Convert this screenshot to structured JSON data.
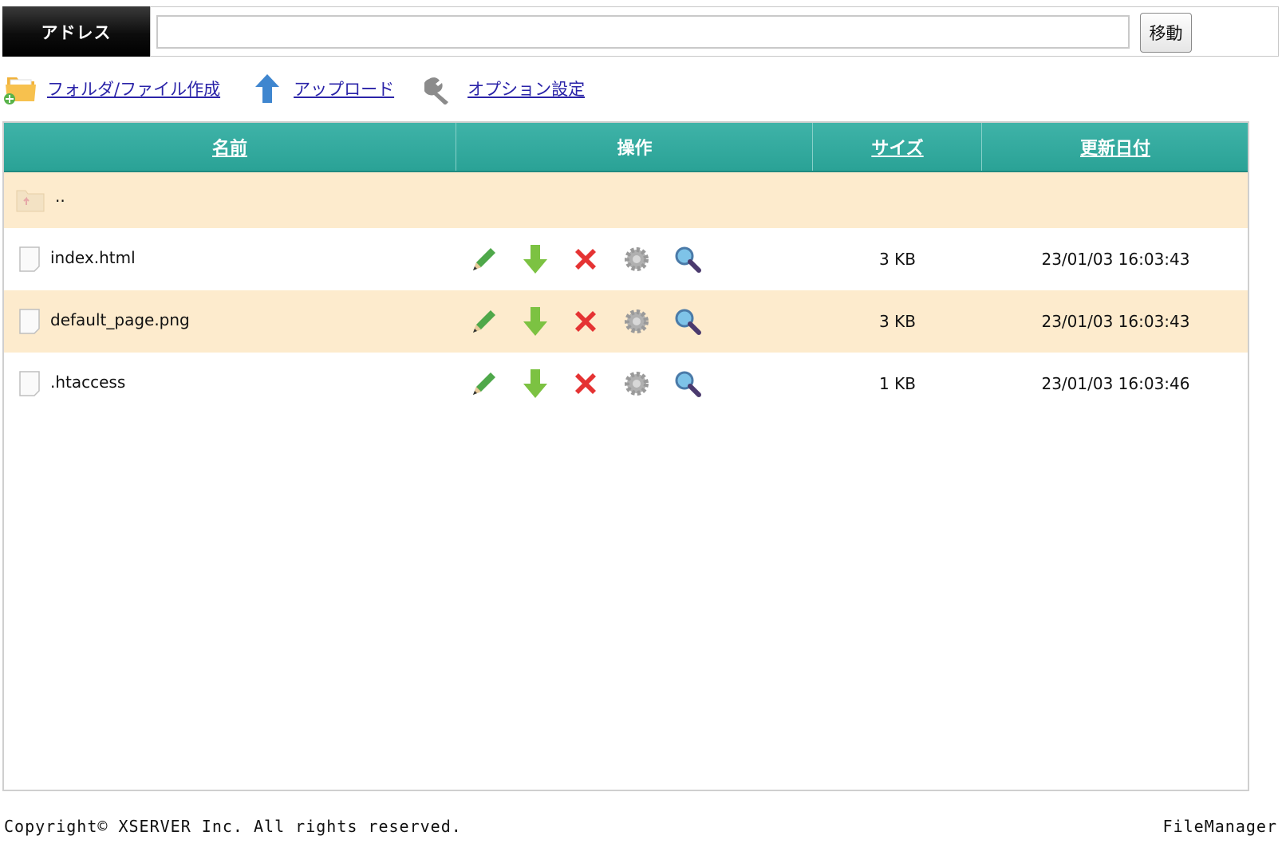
{
  "address": {
    "label": "アドレス",
    "value": "",
    "go_button": "移動"
  },
  "toolbar": {
    "create": "フォルダ/ファイル作成",
    "upload": "アップロード",
    "options": "オプション設定"
  },
  "table": {
    "headers": {
      "name": "名前",
      "ops": "操作",
      "size": "サイズ",
      "date": "更新日付"
    },
    "parent": "..",
    "rows": [
      {
        "name": "index.html",
        "size": "3 KB",
        "date": "23/01/03 16:03:43"
      },
      {
        "name": "default_page.png",
        "size": "3 KB",
        "date": "23/01/03 16:03:43"
      },
      {
        "name": ".htaccess",
        "size": "1 KB",
        "date": "23/01/03 16:03:46"
      }
    ]
  },
  "footer": {
    "copyright": "Copyright© XSERVER Inc. All rights reserved.",
    "brand": "FileManager"
  },
  "colors": {
    "header_teal": "#2aa296",
    "row_highlight": "#fdebcd",
    "link": "#2a23a8"
  }
}
